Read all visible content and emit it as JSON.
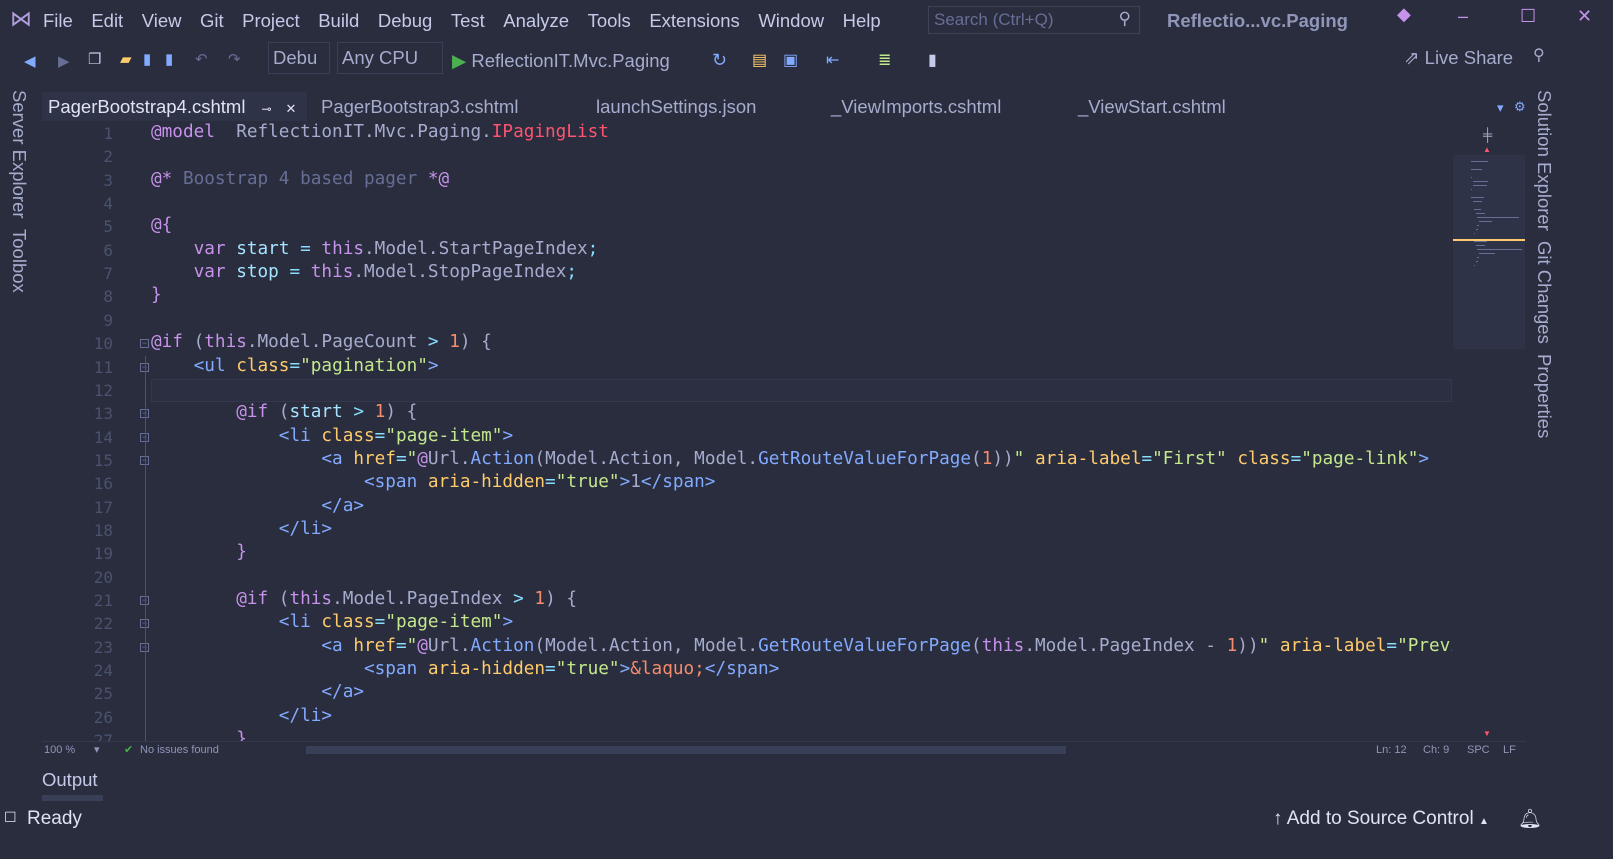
{
  "title_bar": {
    "menu": [
      "File",
      "Edit",
      "View",
      "Git",
      "Project",
      "Build",
      "Debug",
      "Test",
      "Analyze",
      "Tools",
      "Extensions",
      "Window",
      "Help"
    ],
    "search_placeholder": "Search (Ctrl+Q)",
    "window_title": "Reflectio...vc.Paging"
  },
  "toolbar": {
    "configuration": "Debu",
    "platform": "Any CPU",
    "run_target": "ReflectionIT.Mvc.Paging",
    "live_share": "Live Share"
  },
  "tabs": [
    {
      "label": "PagerBootstrap4.cshtml",
      "active": true
    },
    {
      "label": "PagerBootstrap3.cshtml"
    },
    {
      "label": "launchSettings.json"
    },
    {
      "label": "_ViewImports.cshtml"
    },
    {
      "label": "_ViewStart.cshtml"
    }
  ],
  "left_panels": [
    "Server Explorer",
    "Toolbox"
  ],
  "right_panels": [
    "Solution Explorer",
    "Git Changes",
    "Properties"
  ],
  "editor": {
    "current_line": 12,
    "folds": [
      10,
      11,
      13,
      14,
      15,
      21,
      22,
      23
    ],
    "lines": [
      [
        [
          "k",
          "@model"
        ],
        [
          "t",
          "  ReflectionIT.Mvc.Paging."
        ],
        [
          "r",
          "IPagingList"
        ]
      ],
      [],
      [
        [
          "k",
          "@*"
        ],
        [
          "c",
          " Boostrap 4 based pager "
        ],
        [
          "k",
          "*@"
        ]
      ],
      [],
      [
        [
          "k",
          "@{"
        ]
      ],
      [
        [
          "t",
          "    "
        ],
        [
          "k",
          "var"
        ],
        [
          "t",
          " "
        ],
        [
          "v",
          "start"
        ],
        [
          "op",
          " = "
        ],
        [
          "k",
          "this"
        ],
        [
          "t",
          ".Model.StartPageIndex"
        ],
        [
          "op",
          ";"
        ]
      ],
      [
        [
          "t",
          "    "
        ],
        [
          "k",
          "var"
        ],
        [
          "t",
          " "
        ],
        [
          "v",
          "stop"
        ],
        [
          "op",
          " = "
        ],
        [
          "k",
          "this"
        ],
        [
          "t",
          ".Model.StopPageIndex"
        ],
        [
          "op",
          ";"
        ]
      ],
      [
        [
          "k",
          "}"
        ]
      ],
      [],
      [
        [
          "k",
          "@if"
        ],
        [
          "t",
          " ("
        ],
        [
          "k",
          "this"
        ],
        [
          "t",
          ".Model.PageCount "
        ],
        [
          "op",
          ">"
        ],
        [
          "n",
          " 1"
        ],
        [
          "t",
          ") {"
        ]
      ],
      [
        [
          "t",
          "    "
        ],
        [
          "tag",
          "<ul"
        ],
        [
          "at",
          " class"
        ],
        [
          "op",
          "="
        ],
        [
          "s",
          "\"pagination\""
        ],
        [
          "tag",
          ">"
        ]
      ],
      [],
      [
        [
          "t",
          "        "
        ],
        [
          "k",
          "@if"
        ],
        [
          "t",
          " ("
        ],
        [
          "v",
          "start"
        ],
        [
          "op",
          " > "
        ],
        [
          "n",
          "1"
        ],
        [
          "t",
          ") {"
        ]
      ],
      [
        [
          "t",
          "            "
        ],
        [
          "tag",
          "<li"
        ],
        [
          "at",
          " class"
        ],
        [
          "op",
          "="
        ],
        [
          "s",
          "\"page-item\""
        ],
        [
          "tag",
          ">"
        ]
      ],
      [
        [
          "t",
          "                "
        ],
        [
          "tag",
          "<a"
        ],
        [
          "at",
          " href"
        ],
        [
          "op",
          "="
        ],
        [
          "s",
          "\""
        ],
        [
          "k",
          "@"
        ],
        [
          "t",
          "Url."
        ],
        [
          "m",
          "Action"
        ],
        [
          "t",
          "(Model.Action, Model."
        ],
        [
          "m",
          "GetRouteValueForPage"
        ],
        [
          "t",
          "("
        ],
        [
          "n",
          "1"
        ],
        [
          "t",
          "))"
        ],
        [
          "s",
          "\""
        ],
        [
          "at",
          " aria-label"
        ],
        [
          "op",
          "="
        ],
        [
          "s",
          "\"First\""
        ],
        [
          "at",
          " class"
        ],
        [
          "op",
          "="
        ],
        [
          "s",
          "\"page-link\""
        ],
        [
          "tag",
          ">"
        ]
      ],
      [
        [
          "t",
          "                    "
        ],
        [
          "tag",
          "<span"
        ],
        [
          "at",
          " aria-hidden"
        ],
        [
          "op",
          "="
        ],
        [
          "s",
          "\"true\""
        ],
        [
          "tag",
          ">"
        ],
        [
          "t",
          "1"
        ],
        [
          "tag",
          "</span>"
        ]
      ],
      [
        [
          "t",
          "                "
        ],
        [
          "tag",
          "</a>"
        ]
      ],
      [
        [
          "t",
          "            "
        ],
        [
          "tag",
          "</li>"
        ]
      ],
      [
        [
          "t",
          "        "
        ],
        [
          "k",
          "}"
        ]
      ],
      [],
      [
        [
          "t",
          "        "
        ],
        [
          "k",
          "@if"
        ],
        [
          "t",
          " ("
        ],
        [
          "k",
          "this"
        ],
        [
          "t",
          ".Model.PageIndex "
        ],
        [
          "op",
          ">"
        ],
        [
          "n",
          " 1"
        ],
        [
          "t",
          ") {"
        ]
      ],
      [
        [
          "t",
          "            "
        ],
        [
          "tag",
          "<li"
        ],
        [
          "at",
          " class"
        ],
        [
          "op",
          "="
        ],
        [
          "s",
          "\"page-item\""
        ],
        [
          "tag",
          ">"
        ]
      ],
      [
        [
          "t",
          "                "
        ],
        [
          "tag",
          "<a"
        ],
        [
          "at",
          " href"
        ],
        [
          "op",
          "="
        ],
        [
          "s",
          "\""
        ],
        [
          "k",
          "@"
        ],
        [
          "t",
          "Url."
        ],
        [
          "m",
          "Action"
        ],
        [
          "t",
          "(Model.Action, Model."
        ],
        [
          "m",
          "GetRouteValueForPage"
        ],
        [
          "t",
          "("
        ],
        [
          "k",
          "this"
        ],
        [
          "t",
          ".Model.PageIndex - "
        ],
        [
          "n",
          "1"
        ],
        [
          "t",
          "))"
        ],
        [
          "s",
          "\""
        ],
        [
          "at",
          " aria-label"
        ],
        [
          "op",
          "="
        ],
        [
          "s",
          "\"Previous\""
        ]
      ],
      [
        [
          "t",
          "                    "
        ],
        [
          "tag",
          "<span"
        ],
        [
          "at",
          " aria-hidden"
        ],
        [
          "op",
          "="
        ],
        [
          "s",
          "\"true\""
        ],
        [
          "tag",
          ">"
        ],
        [
          "n",
          "&laquo;"
        ],
        [
          "tag",
          "</span>"
        ]
      ],
      [
        [
          "t",
          "                "
        ],
        [
          "tag",
          "</a>"
        ]
      ],
      [
        [
          "t",
          "            "
        ],
        [
          "tag",
          "</li>"
        ]
      ],
      [
        [
          "t",
          "        "
        ],
        [
          "k",
          "}"
        ]
      ]
    ]
  },
  "editor_status": {
    "zoom": "100 %",
    "issues": "No issues found",
    "line": "Ln: 12",
    "char": "Ch: 9",
    "spacing": "SPC",
    "line_ending": "LF"
  },
  "output_tab": "Output",
  "status_bar": {
    "ready": "Ready",
    "source_control": "Add to Source Control"
  }
}
